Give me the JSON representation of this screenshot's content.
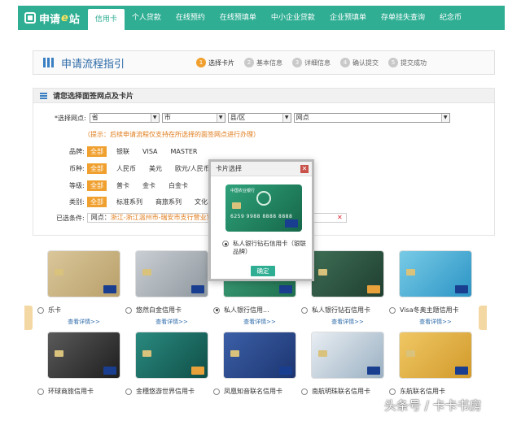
{
  "nav": {
    "logo_pre": "申请",
    "logo_e": "e",
    "logo_post": "站",
    "items": [
      "信用卡",
      "个人贷款",
      "在线预约",
      "在线预填单",
      "中小企业贷款",
      "企业预填单",
      "存单挂失查询",
      "纪念币"
    ]
  },
  "process": {
    "title": "申请流程指引",
    "steps": [
      {
        "num": "1",
        "label": "选择卡片"
      },
      {
        "num": "2",
        "label": "基本信息"
      },
      {
        "num": "3",
        "label": "详细信息"
      },
      {
        "num": "4",
        "label": "确认提交"
      },
      {
        "num": "5",
        "label": "提交成功"
      }
    ]
  },
  "section": {
    "title": "请您选择面签网点及卡片",
    "branch_label": "*选择网点:",
    "province": "省",
    "city": "市",
    "district": "县/区",
    "outlet": "网点",
    "hint": "（提示：后续申请流程仅支持在所选择的面签网点进行办理）",
    "brand_label": "品牌:",
    "brand_tags": [
      "全部",
      "银联",
      "VISA",
      "MASTER"
    ],
    "currency_label": "币种:",
    "currency_tags": [
      "全部",
      "人民币",
      "美元",
      "欧元/人民币"
    ],
    "level_label": "等级:",
    "level_tags": [
      "全部",
      "普卡",
      "金卡",
      "白金卡"
    ],
    "type_label": "类别:",
    "type_tags": [
      "全部",
      "标准系列",
      "商旅系列",
      "文化系列"
    ],
    "cond_label": "已选条件:",
    "cond_prefix": "网点：",
    "cond_value": "浙江-浙江温州市-瑞安市支行营业室"
  },
  "cards": [
    {
      "name": "乐卡",
      "detail": "查看详情>>",
      "checked": false
    },
    {
      "name": "悠然白金信用卡",
      "detail": "查看详情>>",
      "checked": false
    },
    {
      "name": "私人银行信用...",
      "detail": "查看详情>>",
      "checked": true
    },
    {
      "name": "私人银行钻石信用卡",
      "detail": "查看详情>>",
      "checked": false
    },
    {
      "name": "Visa冬奥主题信用卡",
      "detail": "查看详情>>",
      "checked": false
    },
    {
      "name": "环球商旅信用卡",
      "detail": "",
      "checked": false
    },
    {
      "name": "金穗悠游世界信用卡",
      "detail": "",
      "checked": false
    },
    {
      "name": "凤凰知音联名信用卡",
      "detail": "",
      "checked": false
    },
    {
      "name": "南航明珠联名信用卡",
      "detail": "",
      "checked": false
    },
    {
      "name": "东航联名信用卡",
      "detail": "",
      "checked": false
    }
  ],
  "modal": {
    "title": "卡片选择",
    "close": "✕",
    "bank": "中国农业银行",
    "card_number": "6259 9988 8888 8888",
    "option": "私人银行钻石信用卡（银联品牌）",
    "confirm": "确定"
  },
  "watermark": "头条号 / 卡卡书房"
}
